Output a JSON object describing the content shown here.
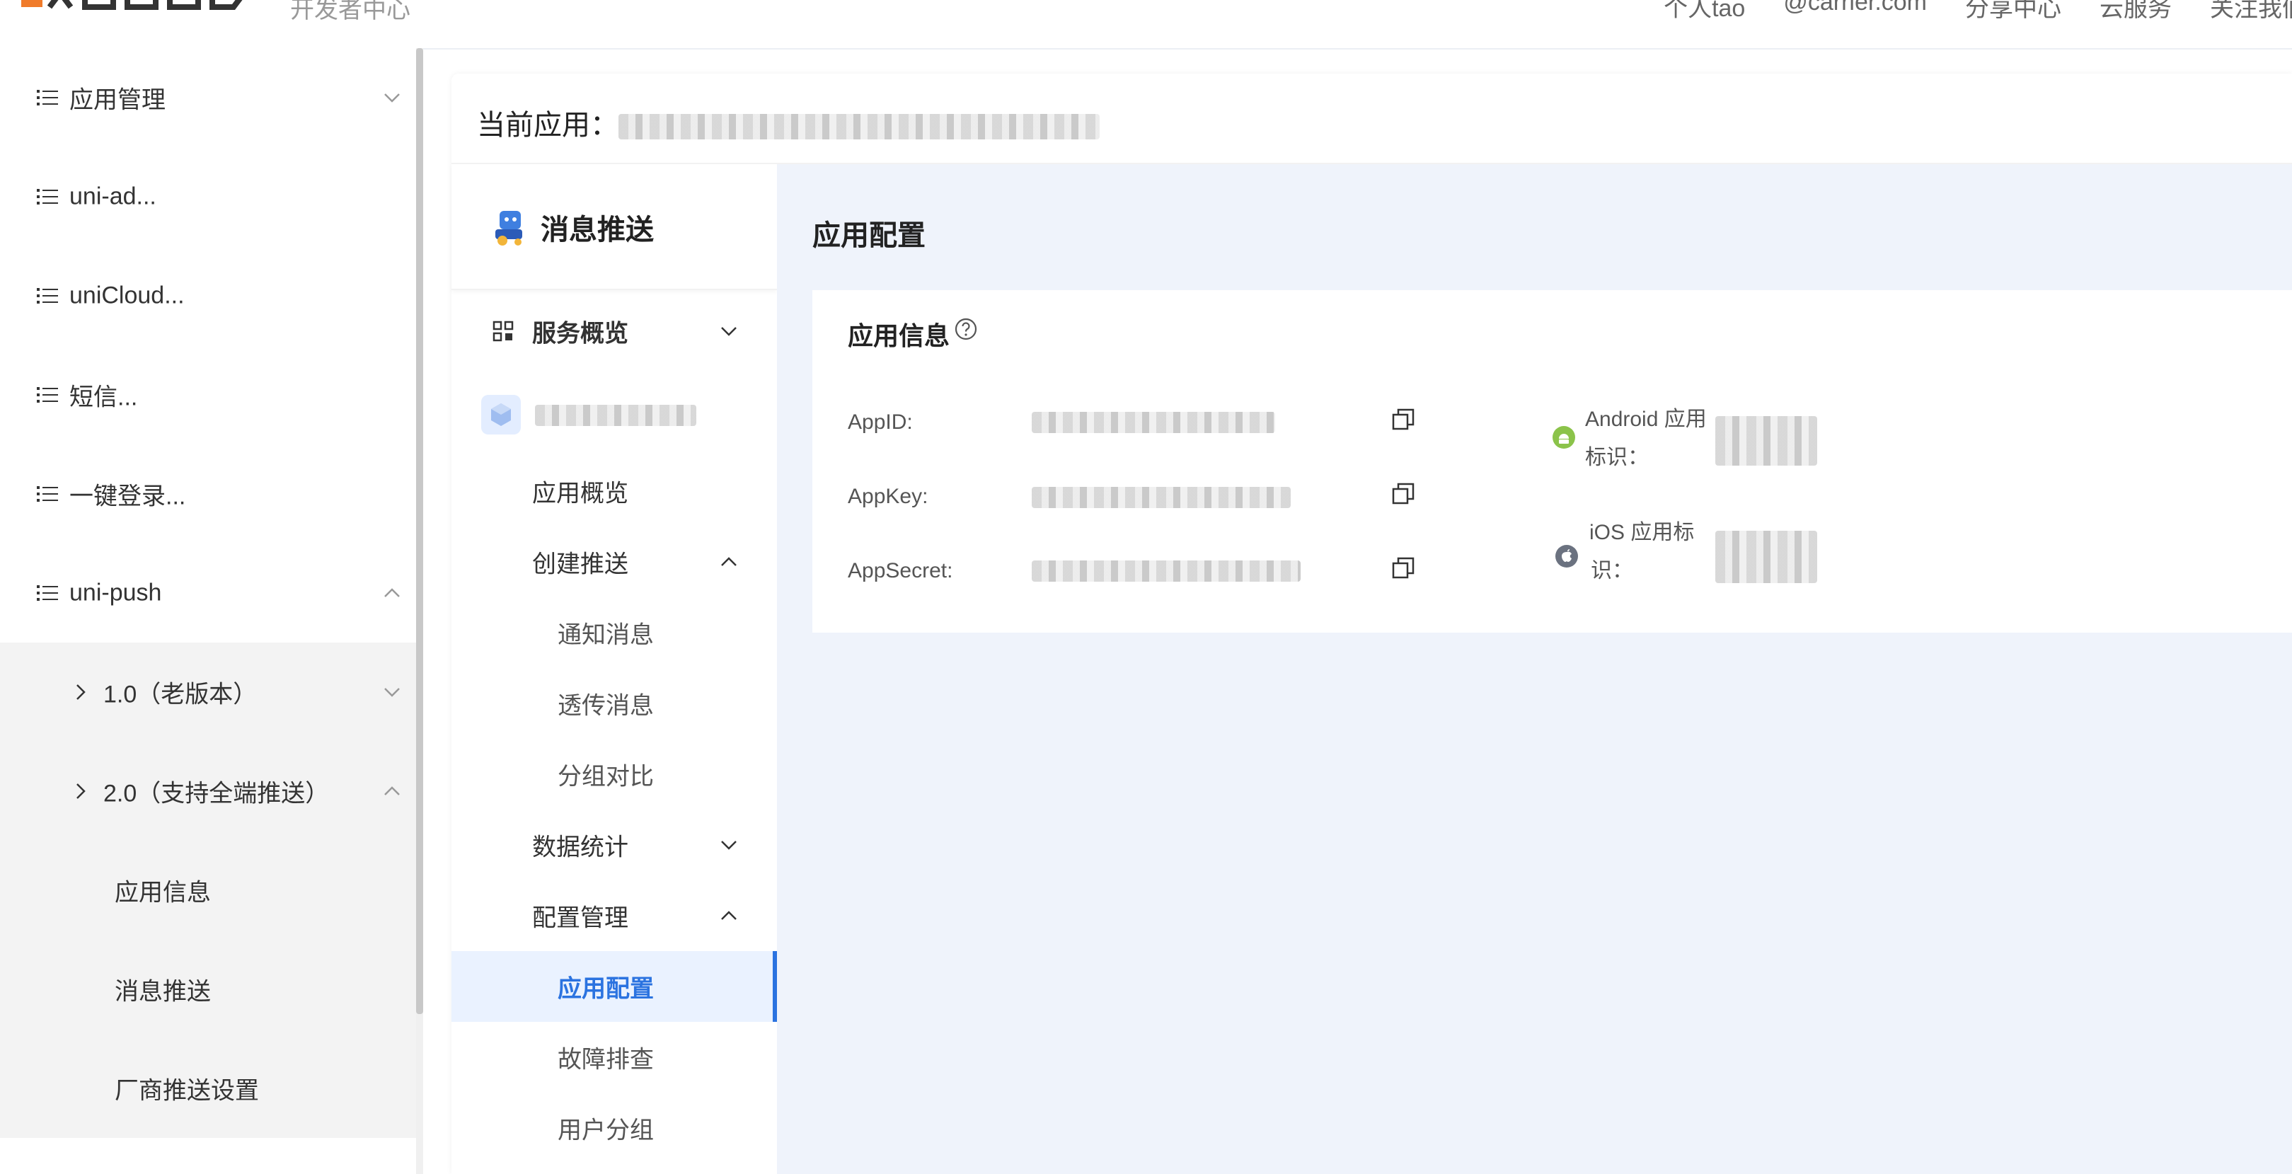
{
  "topbar": {
    "subtitle": "开发者中心",
    "links": [
      "个人tao",
      "@carrier.com",
      "分享中心",
      "云服务",
      "关注我们"
    ]
  },
  "left_menu": {
    "items": [
      {
        "label": "应用管理",
        "expanded": false
      },
      {
        "label": "uni-ad...",
        "expanded": null
      },
      {
        "label": "uniCloud...",
        "expanded": null
      },
      {
        "label": "短信...",
        "expanded": null
      },
      {
        "label": "一键登录...",
        "expanded": null
      },
      {
        "label": "uni-push",
        "expanded": true
      }
    ],
    "sub_items": [
      {
        "label": "1.0（老版本）",
        "expanded": false
      },
      {
        "label": "2.0（支持全端推送）",
        "expanded": true
      }
    ],
    "leaf_items": [
      "应用信息",
      "消息推送",
      "厂商推送设置"
    ]
  },
  "header": {
    "current_app_label": "当前应用："
  },
  "service_menu": {
    "title": "消息推送",
    "overview_label": "服务概览",
    "items": [
      {
        "label": "应用概览",
        "level": 1
      },
      {
        "label": "创建推送",
        "level": 1,
        "expanded": true
      },
      {
        "label": "通知消息",
        "level": 2
      },
      {
        "label": "透传消息",
        "level": 2
      },
      {
        "label": "分组对比",
        "level": 2
      },
      {
        "label": "数据统计",
        "level": 1,
        "expanded": false
      },
      {
        "label": "配置管理",
        "level": 1,
        "expanded": true
      },
      {
        "label": "应用配置",
        "level": 2,
        "active": true
      },
      {
        "label": "故障排查",
        "level": 2
      },
      {
        "label": "用户分组",
        "level": 2
      }
    ]
  },
  "content": {
    "title": "应用配置",
    "panel_title": "应用信息",
    "rows": [
      {
        "label": "AppID:"
      },
      {
        "label": "AppKey:"
      },
      {
        "label": "AppSecret:"
      }
    ],
    "android_label_line1": "Android 应用",
    "android_label_line2": "标识：",
    "ios_label_line1": "iOS 应用标",
    "ios_label_line2": "识："
  },
  "colors": {
    "accent": "#2b73e0",
    "content_bg": "#eff3fb",
    "submenu_bg": "#f3f3f3",
    "android_green": "#8bc34a",
    "ios_gray": "#6b7280"
  }
}
